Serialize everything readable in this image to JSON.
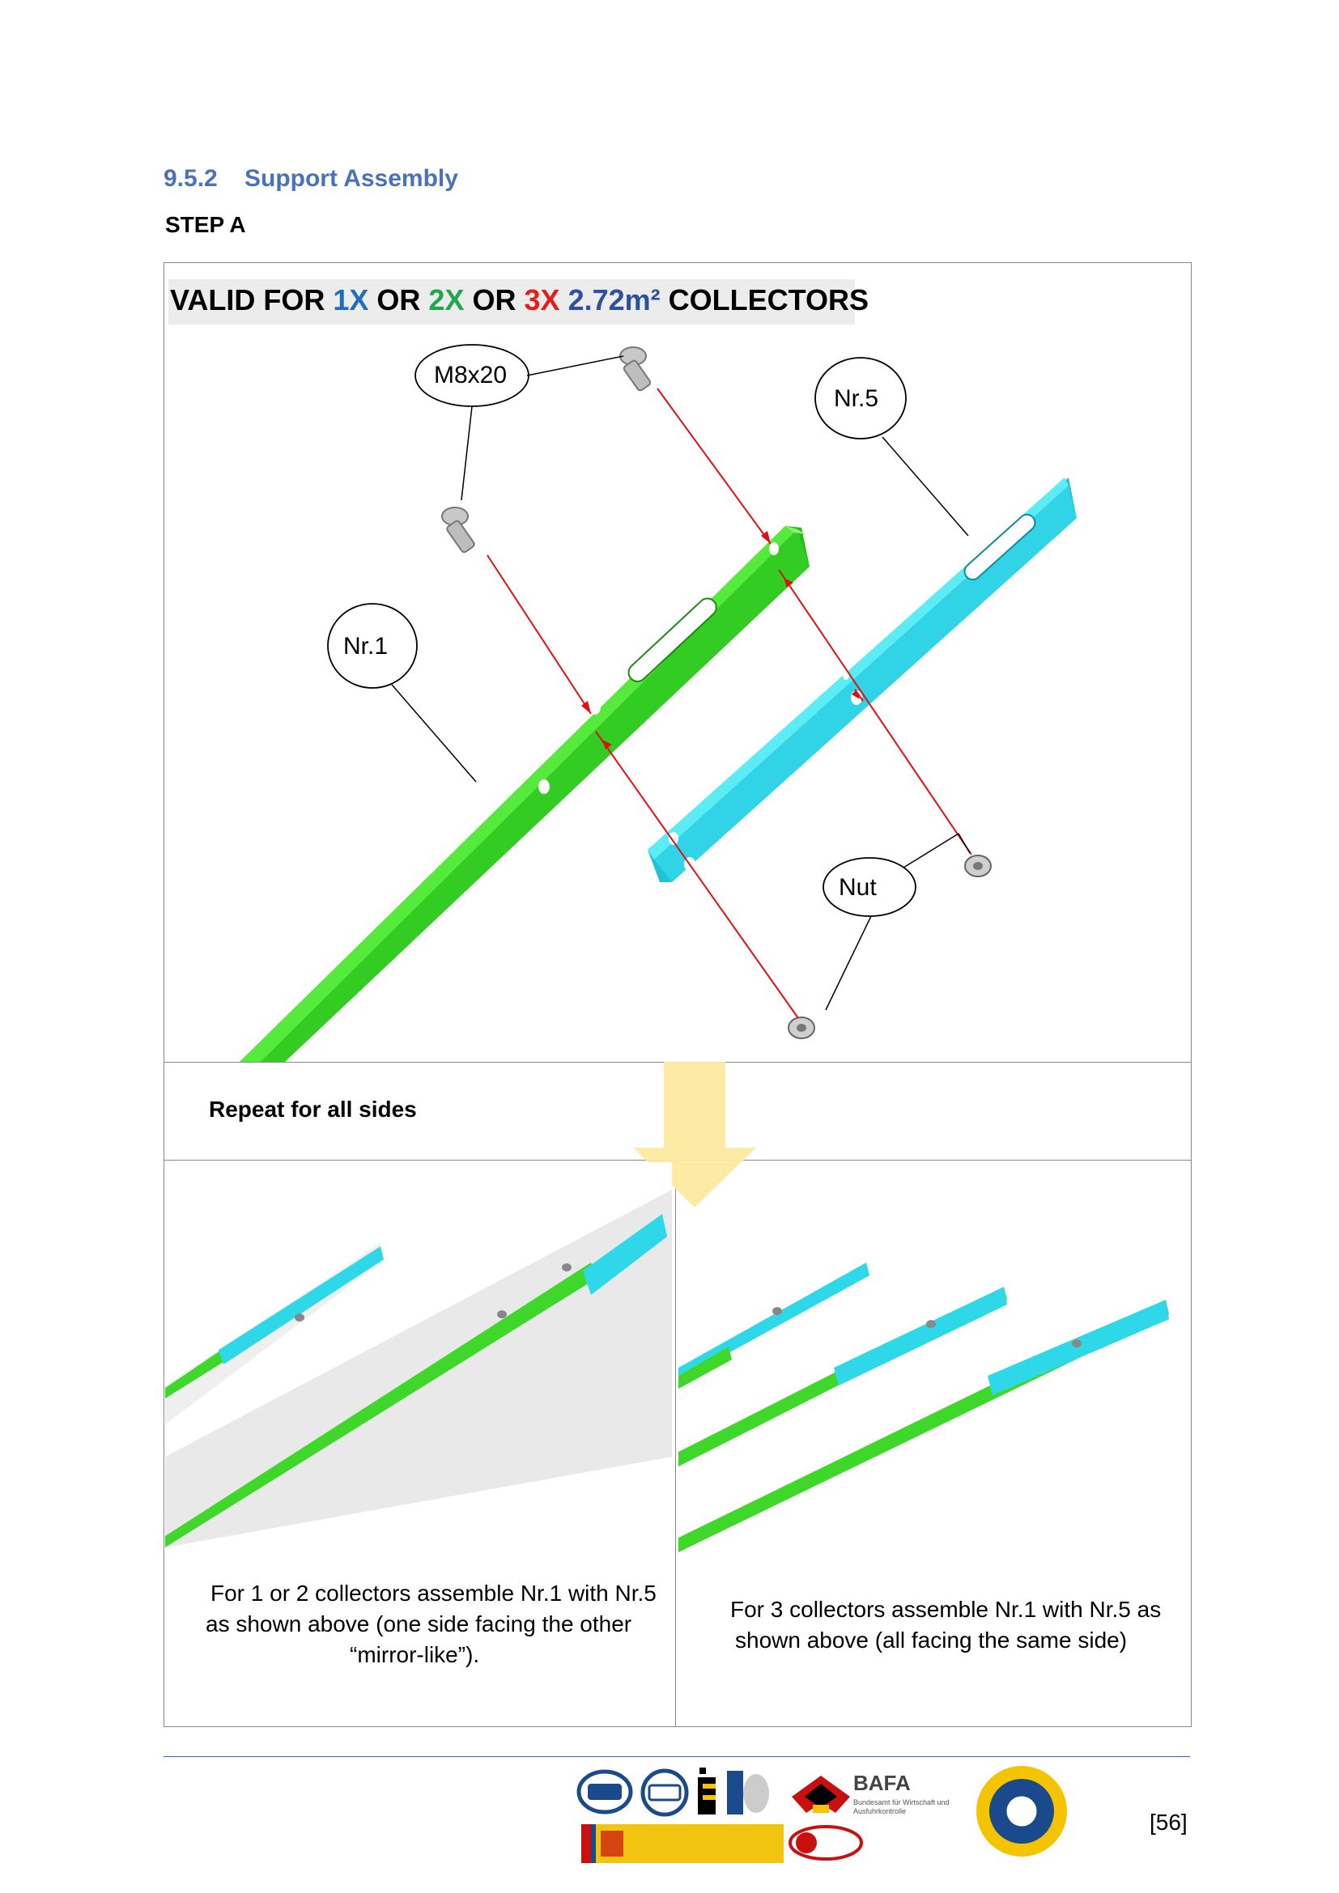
{
  "section": {
    "number": "9.5.2",
    "title": "Support Assembly"
  },
  "step_label": "STEP A",
  "banner": {
    "prefix": "VALID FOR",
    "opt1": "1X",
    "or1": "OR",
    "opt2": "2X",
    "or2": "OR",
    "opt3": "3X",
    "size": "2.72m²",
    "suffix": "COLLECTORS"
  },
  "callouts": {
    "bolt": "M8x20",
    "part5": "Nr.5",
    "part1": "Nr.1",
    "nut": "Nut"
  },
  "repeat_note": "Repeat for all sides",
  "captions": {
    "left_line1": "For 1 or 2 collectors assemble Nr.1 with Nr.5",
    "left_line2": "as shown above (one side facing the other",
    "left_line3": "“mirror-like”).",
    "right_line1": "For 3 collectors assemble Nr.1 with Nr.5 as",
    "right_line2": "shown above (all facing the same side)"
  },
  "footer": {
    "logo_bafa": "BAFA",
    "logo_bafa_sub": "Bundesamt für Wirtschaft und Ausfuhrkontrolle",
    "page_number": "[56]"
  },
  "colors": {
    "heading": "#4a72b8",
    "part1_green": "#3fd82a",
    "part5_cyan": "#2fd8e8",
    "assembly_line": "#e01010",
    "arrow_yellow": "#fde9a0",
    "footer_rule": "#3a64c4"
  }
}
